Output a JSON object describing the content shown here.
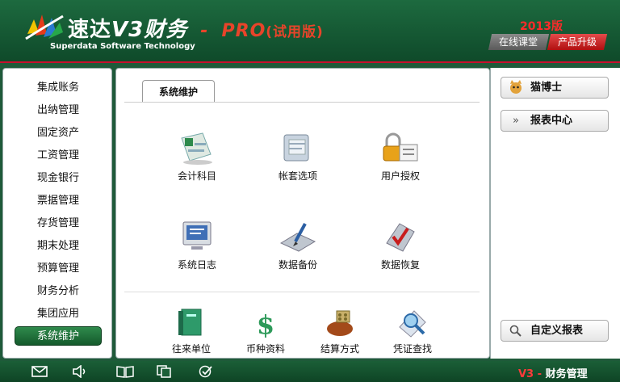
{
  "header": {
    "brand_name": "速达",
    "brand_version": "V3财务",
    "brand_dash": "-",
    "brand_pro": "PRO",
    "brand_trial": "(试用版)",
    "subtitle": "Superdata Software Technology",
    "year_label": "2013版",
    "online_class": "在线课堂",
    "upgrade": "产品升级"
  },
  "sidebar": {
    "items": [
      {
        "label": "集成账务"
      },
      {
        "label": "出纳管理"
      },
      {
        "label": "固定资产"
      },
      {
        "label": "工资管理"
      },
      {
        "label": "现金银行"
      },
      {
        "label": "票据管理"
      },
      {
        "label": "存货管理"
      },
      {
        "label": "期末处理"
      },
      {
        "label": "预算管理"
      },
      {
        "label": "财务分析"
      },
      {
        "label": "集团应用"
      },
      {
        "label": "系统维护"
      }
    ],
    "active_index": 11
  },
  "main": {
    "tab_label": "系统维护",
    "functions": [
      {
        "label": "会计科目",
        "icon": "accounts-icon"
      },
      {
        "label": "帐套选项",
        "icon": "folder-options-icon"
      },
      {
        "label": "用户授权",
        "icon": "lock-icon"
      },
      {
        "label": "系统日志",
        "icon": "monitor-icon"
      },
      {
        "label": "数据备份",
        "icon": "backup-icon"
      },
      {
        "label": "数据恢复",
        "icon": "restore-icon"
      }
    ],
    "bottom_functions": [
      {
        "label": "往来单位",
        "icon": "book-icon"
      },
      {
        "label": "币种资料",
        "icon": "currency-icon"
      },
      {
        "label": "结算方式",
        "icon": "settlement-icon"
      },
      {
        "label": "凭证查找",
        "icon": "magnifier-icon"
      }
    ]
  },
  "right": {
    "buttons": [
      {
        "label": "猫博士",
        "icon": "cat-icon"
      },
      {
        "label": "报表中心",
        "icon": "chevrons-icon"
      },
      {
        "label": "自定义报表",
        "icon": "search-icon"
      }
    ]
  },
  "footer": {
    "icons": [
      "mail-icon",
      "speaker-icon",
      "book-open-icon",
      "copy-icon",
      "check-icon"
    ],
    "version": "V3 -",
    "module": "财务管理"
  },
  "colors": {
    "brand_green": "#1d6a3f",
    "accent_red": "#c8102e",
    "active_green": "#2f8a4c"
  }
}
